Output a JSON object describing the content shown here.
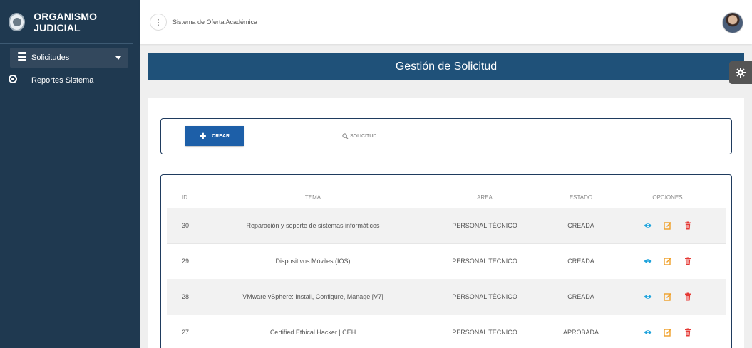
{
  "brand": {
    "title": "ORGANISMO JUDICIAL"
  },
  "sidebar": {
    "items": [
      {
        "label": "Solicitudes",
        "icon": "server-icon"
      },
      {
        "label": "Reportes Sistema",
        "icon": "radio-icon"
      }
    ]
  },
  "topbar": {
    "app_name": "Sistema de Oferta Académica",
    "menu_glyph": "⋮"
  },
  "page": {
    "title": "Gestión de Solicitud"
  },
  "toolbar": {
    "create_label": "CREAR",
    "create_glyph": "✚",
    "search_placeholder": "SOLICITUD"
  },
  "table": {
    "headers": {
      "id": "ID",
      "tema": "TEMA",
      "area": "AREA",
      "estado": "ESTADO",
      "opciones": "OPCIONES"
    },
    "rows": [
      {
        "id": "30",
        "tema": "Reparación y soporte de sistemas informáticos",
        "area": "PERSONAL TÉCNICO",
        "estado": "CREADA"
      },
      {
        "id": "29",
        "tema": "Dispositivos Móviles (IOS)",
        "area": "PERSONAL TÉCNICO",
        "estado": "CREADA"
      },
      {
        "id": "28",
        "tema": "VMware vSphere: Install, Configure, Manage [V7]",
        "area": "PERSONAL TÉCNICO",
        "estado": "CREADA"
      },
      {
        "id": "27",
        "tema": "Certified Ethical Hacker | CEH",
        "area": "PERSONAL TÉCNICO",
        "estado": "APROBADA"
      }
    ]
  },
  "colors": {
    "sidebar": "#1f3950",
    "header": "#1f5179",
    "primary_button": "#1d5fa8",
    "view_icon": "#1fa3dc",
    "edit_icon": "#f0a028",
    "delete_icon": "#e53935"
  }
}
